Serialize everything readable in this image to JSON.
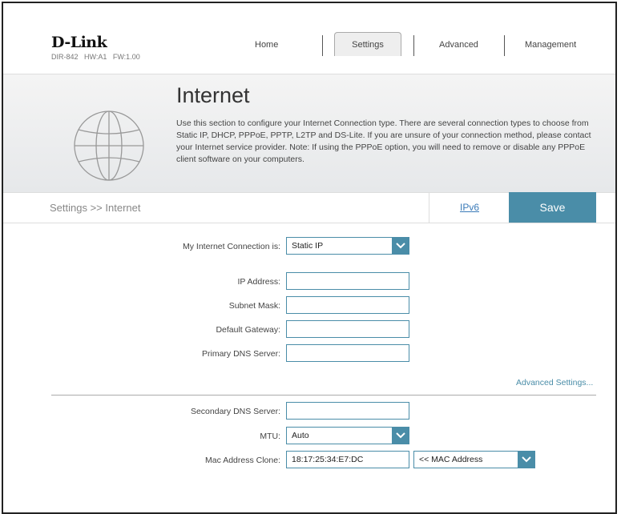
{
  "header": {
    "brand": "D-Link",
    "model": "DIR-842   HW:A1   FW:1.00",
    "nav": [
      "Home",
      "Settings",
      "Advanced",
      "Management"
    ],
    "active_nav": "Settings"
  },
  "banner": {
    "title": "Internet",
    "description": "Use this section to configure your Internet Connection type. There are several connection types to choose from Static IP, DHCP, PPPoE, PPTP, L2TP and DS-Lite. If you are unsure of your connection method, please contact your Internet service provider. Note: If using the PPPoE option, you will need to remove or disable any PPPoE client software on your computers."
  },
  "breadcrumb": "Settings >> Internet",
  "ipv6_link": "IPv6",
  "save_label": "Save",
  "form": {
    "connection_label": "My Internet Connection is:",
    "connection_value": "Static IP",
    "ip_label": "IP Address:",
    "ip_value": "",
    "subnet_label": "Subnet Mask:",
    "subnet_value": "",
    "gateway_label": "Default Gateway:",
    "gateway_value": "",
    "dns1_label": "Primary DNS Server:",
    "dns1_value": "",
    "advanced_link": "Advanced Settings...",
    "dns2_label": "Secondary DNS Server:",
    "dns2_value": "",
    "mtu_label": "MTU:",
    "mtu_value": "Auto",
    "mac_label": "Mac Address Clone:",
    "mac_value": "18:17:25:34:E7:DC",
    "mac_select_value": "<< MAC Address"
  },
  "colors": {
    "accent": "#4a8da8",
    "link": "#3a7ab8"
  }
}
